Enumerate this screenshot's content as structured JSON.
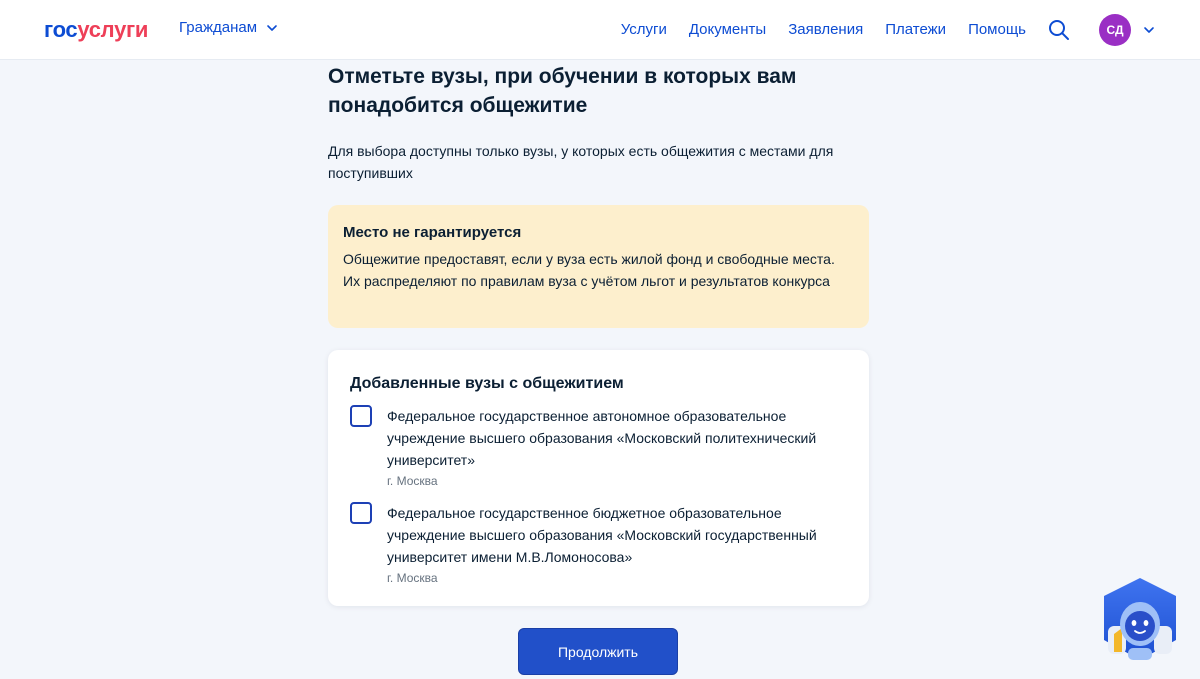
{
  "header": {
    "logo_part1": "гос",
    "logo_part2": "услуги",
    "citizens_menu": "Гражданам",
    "nav": [
      "Услуги",
      "Документы",
      "Заявления",
      "Платежи",
      "Помощь"
    ],
    "avatar_initials": "СД"
  },
  "main": {
    "title": "Отметьте вузы, при обучении в которых вам понадобится общежитие",
    "description": "Для выбора доступны только вузы, у которых есть общежития с местами для поступивших",
    "warning": {
      "title": "Место не гарантируется",
      "text": "Общежитие предоставят, если у вуза есть жилой фонд и свободные места. Их распределяют по правилам вуза с учётом льгот и результатов конкурса"
    },
    "card": {
      "title": "Добавленные вузы с общежитием",
      "items": [
        {
          "name": "Федеральное государственное автономное образовательное учреждение высшего образования «Московский политехнический университет»",
          "city": "г. Москва",
          "checked": false
        },
        {
          "name": "Федеральное государственное бюджетное образовательное учреждение высшего образования «Московский государственный университет имени М.В.Ломоносова»",
          "city": "г. Москва",
          "checked": false
        }
      ]
    },
    "continue_label": "Продолжить"
  },
  "colors": {
    "brand_blue": "#0d4cd3",
    "brand_red": "#ee3f58",
    "button_blue": "#2150c9",
    "warning_bg": "#fdefcd",
    "avatar_bg": "#9a2fc4",
    "page_bg": "#f3f6fb"
  },
  "icons": {
    "search": "search-icon",
    "chevron": "chevron-down-icon",
    "assistant": "robot-assistant-icon"
  }
}
